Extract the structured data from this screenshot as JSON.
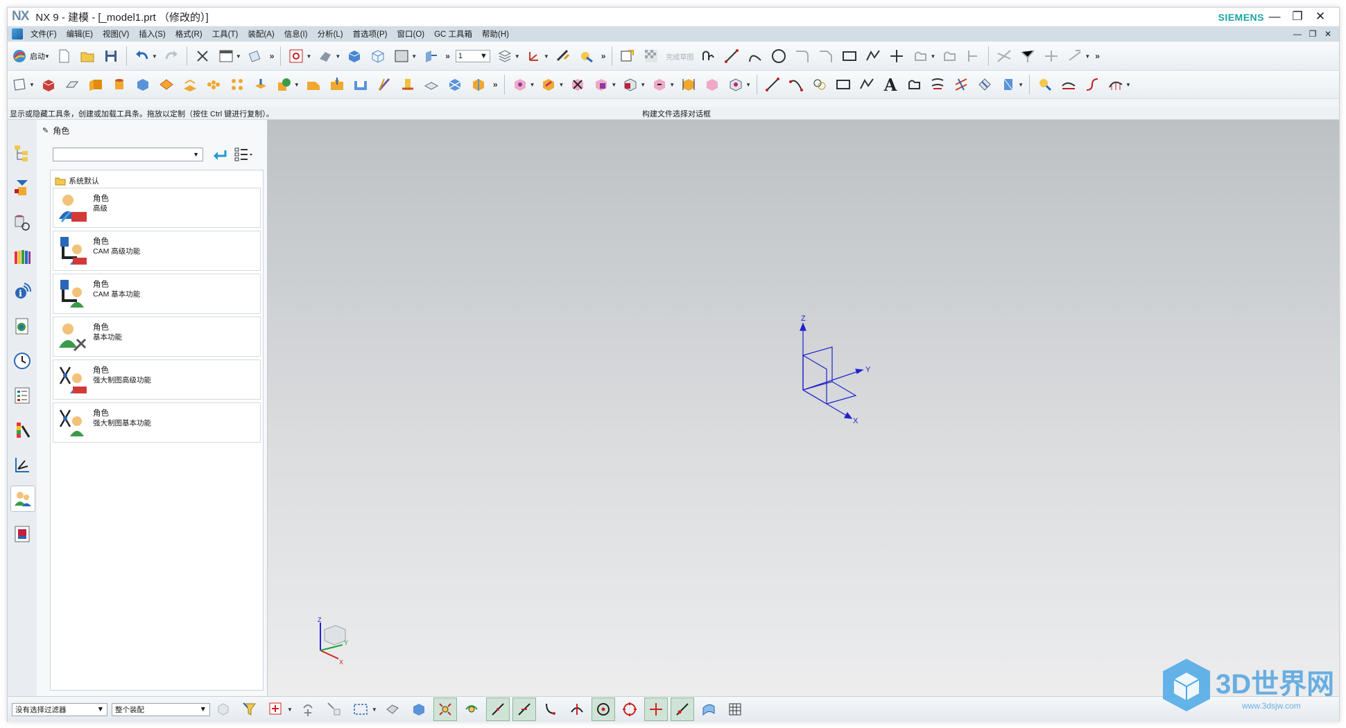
{
  "window": {
    "logo": "NX",
    "title": "NX 9 - 建模 - [_model1.prt （修改的）]",
    "brand": "SIEMENS",
    "controls": {
      "minimize": "—",
      "restore": "❐",
      "close": "✕"
    }
  },
  "menu": {
    "items": [
      "文件(F)",
      "编辑(E)",
      "视图(V)",
      "插入(S)",
      "格式(R)",
      "工具(T)",
      "装配(A)",
      "信息(I)",
      "分析(L)",
      "首选项(P)",
      "窗口(O)",
      "GC 工具箱",
      "帮助(H)"
    ],
    "mdi": {
      "minimize": "—",
      "restore": "❐",
      "close": "✕"
    }
  },
  "toolbar": {
    "start_label": "启动",
    "layer_value": "1",
    "finish_sketch_label": "完成草图",
    "text_tool": "A"
  },
  "hints": {
    "left": "显示或隐藏工具条，创建或加载工具条。拖放以定制（按住 Ctrl 键进行复制）。",
    "center": "构建文件选择对话框"
  },
  "panel": {
    "title": "角色",
    "combo_value": "",
    "folder": "系统默认",
    "roles": [
      {
        "name": "角色",
        "desc": "高级"
      },
      {
        "name": "角色",
        "desc": "CAM 高级功能"
      },
      {
        "name": "角色",
        "desc": "CAM 基本功能"
      },
      {
        "name": "角色",
        "desc": "基本功能"
      },
      {
        "name": "角色",
        "desc": "强大制图高级功能"
      },
      {
        "name": "角色",
        "desc": "强大制图基本功能"
      }
    ]
  },
  "viewport": {
    "axis_labels": {
      "z": "Z",
      "y": "Y",
      "x": "X"
    },
    "small_axis_labels": {
      "z": "Z",
      "y": "Y",
      "x": "X"
    }
  },
  "statusbar": {
    "filter_value": "没有选择过滤器",
    "scope_value": "整个装配"
  },
  "watermark": {
    "text": "3D世界网",
    "url": "www.3dsjw.com"
  },
  "colors": {
    "accent": "#1aa3a3",
    "menubar": "#d3dde6",
    "axis": "#2222cc"
  }
}
